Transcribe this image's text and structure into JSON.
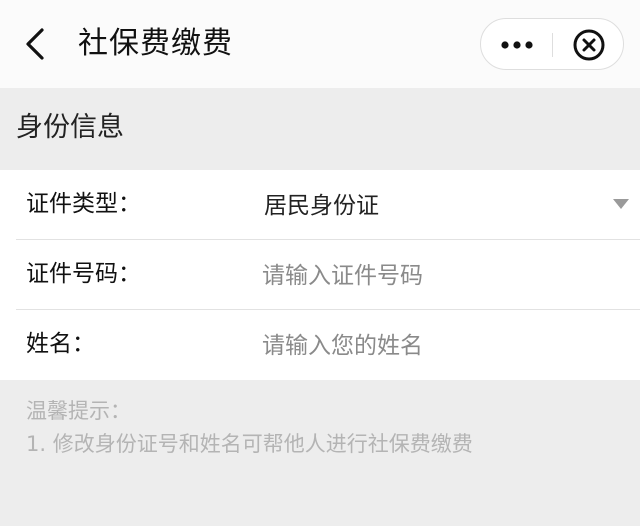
{
  "navbar": {
    "title": "社保费缴费",
    "back_icon": "chevron-left-icon",
    "more_icon": "more-dots-icon",
    "close_icon": "close-circle-icon"
  },
  "section": {
    "title": "身份信息"
  },
  "form": {
    "id_type": {
      "label": "证件类型：",
      "value": "居民身份证",
      "icon": "dropdown-triangle-icon"
    },
    "id_number": {
      "label": "证件号码：",
      "value": "",
      "placeholder": "请输入证件号码"
    },
    "name": {
      "label": "姓名：",
      "value": "",
      "placeholder": "请输入您的姓名"
    }
  },
  "tips": {
    "title": "温馨提示：",
    "lines": [
      "1. 修改身份证号和姓名可帮他人进行社保费缴费"
    ]
  },
  "colors": {
    "navbar_bg": "#fbfbfb",
    "page_bg": "#ededed",
    "form_bg": "#ffffff",
    "placeholder": "#8a8a8a",
    "tip_text": "#b4b4b4"
  }
}
